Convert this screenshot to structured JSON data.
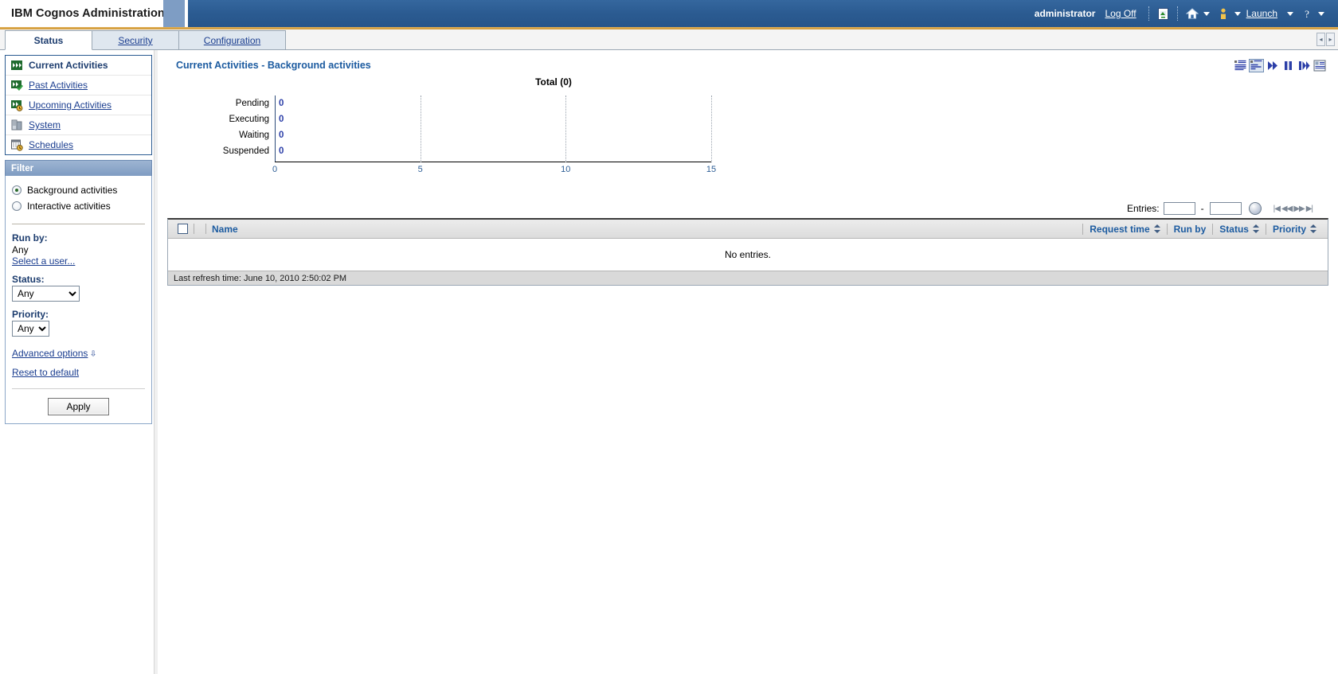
{
  "banner": {
    "title": "IBM Cognos Administration",
    "user": "administrator",
    "logoff_label": "Log Off",
    "refresh_icon": "refresh-page-icon",
    "home_icon": "home-icon",
    "my_area_icon": "my-area-person-icon",
    "launch_label": "Launch",
    "help_icon": "help-question-icon"
  },
  "tabs": [
    {
      "label": "Status",
      "active": true
    },
    {
      "label": "Security",
      "active": false
    },
    {
      "label": "Configuration",
      "active": false
    }
  ],
  "sidebar": {
    "nav": [
      {
        "label": "Current Activities",
        "icon": "current-activities-icon",
        "current": true
      },
      {
        "label": "Past Activities",
        "icon": "past-activities-icon",
        "current": false
      },
      {
        "label": "Upcoming Activities",
        "icon": "upcoming-activities-icon",
        "current": false
      },
      {
        "label": "System",
        "icon": "system-servers-icon",
        "current": false
      },
      {
        "label": "Schedules",
        "icon": "schedules-calendar-icon",
        "current": false
      }
    ],
    "filter": {
      "header": "Filter",
      "radios": [
        {
          "label": "Background activities",
          "selected": true
        },
        {
          "label": "Interactive activities",
          "selected": false
        }
      ],
      "run_by_label": "Run by:",
      "run_by_value": "Any",
      "select_user_link": "Select a user...",
      "status_label": "Status:",
      "status_value": "Any",
      "status_options": [
        "Any"
      ],
      "priority_label": "Priority:",
      "priority_value": "Any",
      "priority_options": [
        "Any"
      ],
      "advanced_options_link": "Advanced options",
      "reset_link": "Reset to default",
      "apply_label": "Apply"
    }
  },
  "content": {
    "page_title": "Current Activities - Background activities",
    "toolbar_icons": [
      "list-view-icon",
      "chart-view-icon",
      "run-icon",
      "pause-icon",
      "resume-icon",
      "properties-icon"
    ],
    "entries": {
      "label": "Entries:",
      "from_value": "",
      "to_value": "",
      "go_icon": "go-button-icon",
      "pager": [
        "first-page-icon",
        "prev-page-icon",
        "next-page-icon",
        "last-page-icon"
      ]
    },
    "grid": {
      "select_all_checkbox": "select-all-checkbox",
      "columns": [
        {
          "label": "Name",
          "sortable": false
        },
        {
          "label": "Request time",
          "sortable": true
        },
        {
          "label": "Run by",
          "sortable": false
        },
        {
          "label": "Status",
          "sortable": true
        },
        {
          "label": "Priority",
          "sortable": true
        }
      ],
      "empty_message": "No entries.",
      "footer": "Last refresh time: June 10, 2010 2:50:02 PM"
    }
  },
  "chart_data": {
    "type": "bar",
    "title": "Total (0)",
    "orientation": "horizontal",
    "categories": [
      "Pending",
      "Executing",
      "Waiting",
      "Suspended"
    ],
    "values": [
      0,
      0,
      0,
      0
    ],
    "data_labels": [
      "0",
      "0",
      "0",
      "0"
    ],
    "xlabel": "",
    "ylabel": "",
    "xlim": [
      0,
      15
    ],
    "xticks": [
      0,
      5,
      10,
      15
    ],
    "xtick_labels": [
      "0",
      "5",
      "10",
      "15"
    ],
    "grid": true,
    "legend": false,
    "bar_color": "#2c3fa8",
    "label_color": "#2c3fa8",
    "axis_color": "#2e5f96"
  }
}
